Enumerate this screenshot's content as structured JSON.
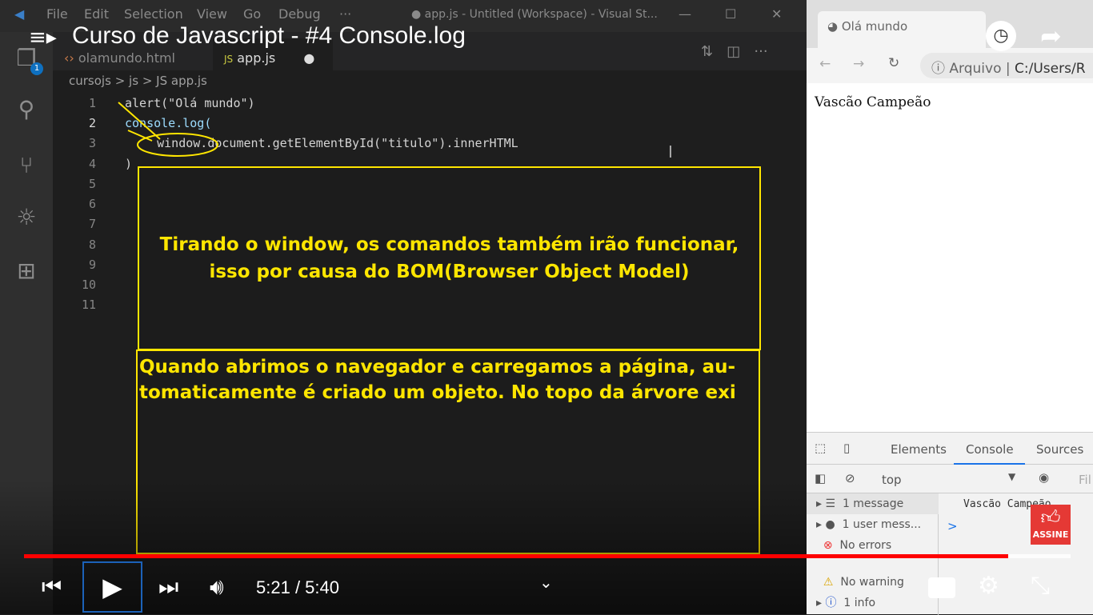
{
  "video": {
    "title": "Curso de Javascript - #4 Console.log",
    "current_time": "5:21",
    "separator": " / ",
    "duration": "5:40",
    "progress_fraction": 0.94,
    "buffered_fraction": 1.0,
    "subscribe_label": "ASSINE"
  },
  "vscode": {
    "menu": [
      "File",
      "Edit",
      "Selection",
      "View",
      "Go",
      "Debug",
      "···"
    ],
    "window_title": "● app.js - Untitled (Workspace) - Visual St...",
    "explorer_badge": "1",
    "tabs": [
      {
        "label": "olamundo.html"
      },
      {
        "label": "app.js"
      }
    ],
    "breadcrumb": [
      "cursojs",
      ">",
      "js",
      ">",
      "JS app.js"
    ],
    "line_numbers": [
      "1",
      "2",
      "3",
      "4",
      "5",
      "6",
      "7",
      "8",
      "9",
      "10",
      "11"
    ],
    "code": [
      "alert(\"Olá mundo\")",
      "console.log(",
      "    window.document.getElementById(\"titulo\").innerHTML",
      ")"
    ]
  },
  "annotations": {
    "box1": "Tirando o window, os comandos também irão funcionar, isso por causa do BOM(Browser Object Model)",
    "box2_line1": "Quando abrimos o navegador e carregamos a página,  au-",
    "box2_line2": "tomaticamente é criado um objeto. No topo da árvore exi"
  },
  "browser": {
    "tab_title": "Olá mundo",
    "address_label": "Arquivo",
    "address": "C:/Users/R",
    "page_text": "Vascão Campeão",
    "devtools": {
      "tabs": [
        "Elements",
        "Console",
        "Sources"
      ],
      "context": "top",
      "filter": "Fil",
      "sidebar": [
        "1 message",
        "1 user mess...",
        "No errors",
        "No warning",
        "1 info"
      ],
      "console_output": "Vascão Campeão",
      "prompt": ">"
    }
  }
}
